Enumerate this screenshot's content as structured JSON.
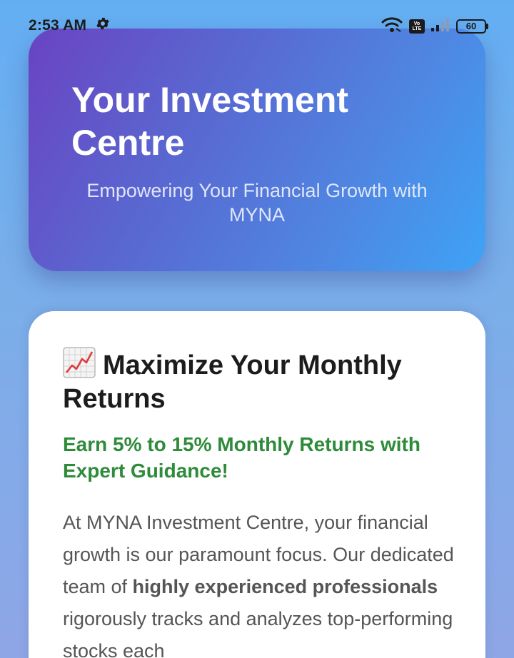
{
  "status_bar": {
    "time": "2:53 AM",
    "volte_label": "Vo LTE",
    "battery": "60"
  },
  "hero": {
    "title": "Your Investment Centre",
    "subtitle": "Empowering Your Financial Growth with MYNA"
  },
  "card": {
    "icon": "chart-increasing-icon",
    "heading": "Maximize Your Monthly Returns",
    "highlight": "Earn 5% to 15% Monthly Returns with Expert Guidance!",
    "body_part1": "At MYNA Investment Centre, your financial growth is our paramount focus. Our dedicated team of ",
    "body_bold": "highly experienced professionals",
    "body_part2": " rigorously tracks and analyzes top-performing stocks each"
  },
  "colors": {
    "highlight": "#2e8b3a",
    "hero_start": "#6a43c2",
    "hero_end": "#3ea3f5"
  }
}
